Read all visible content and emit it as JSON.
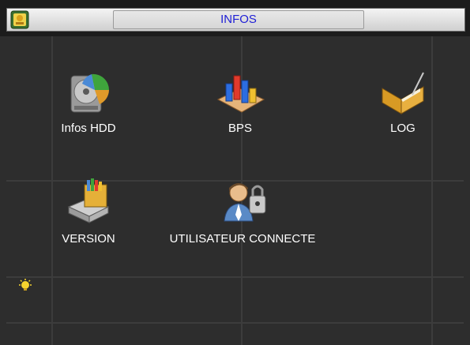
{
  "window": {
    "title": "INFOS",
    "app_icon": "info-app-icon"
  },
  "tiles": [
    {
      "label": "Infos HDD",
      "icon": "hard-disk-icon"
    },
    {
      "label": "BPS",
      "icon": "bar-chart-icon"
    },
    {
      "label": "LOG",
      "icon": "log-book-icon"
    },
    {
      "label": "VERSION",
      "icon": "version-box-icon"
    },
    {
      "label": "UTILISATEUR CONNECTE",
      "icon": "user-lock-icon"
    }
  ],
  "tip": {
    "icon": "lightbulb-icon"
  },
  "colors": {
    "title_text": "#1f1fd6",
    "background": "#2e2e2e",
    "grid": "#3c3c3c",
    "label_text": "#ffffff"
  }
}
